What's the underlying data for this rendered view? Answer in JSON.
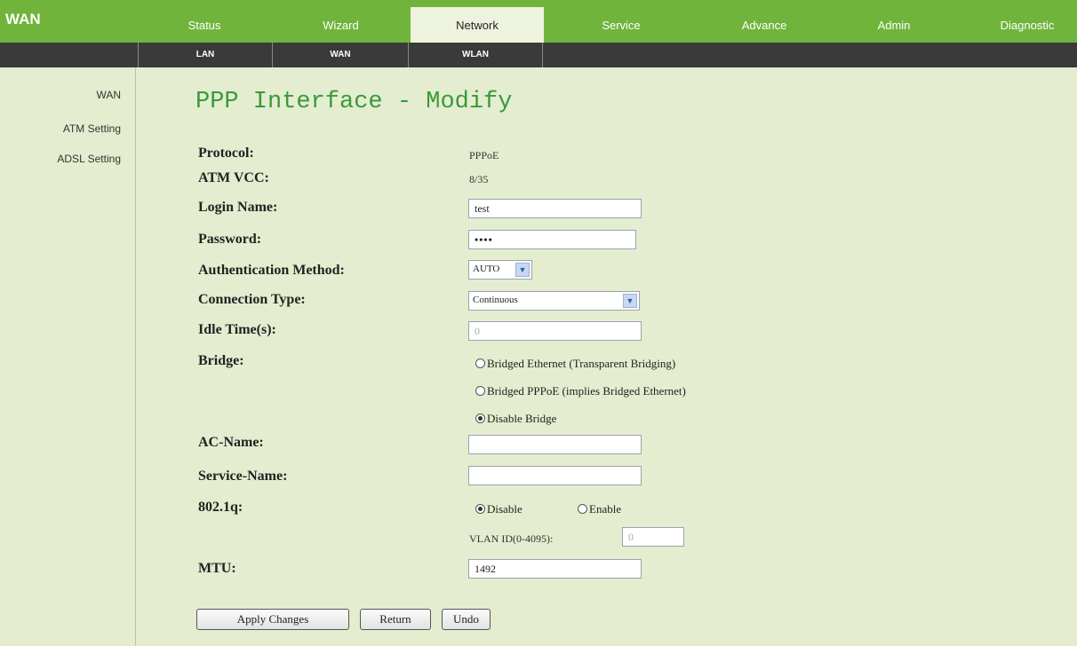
{
  "brand": "WAN",
  "nav": {
    "tabs": [
      "Status",
      "Wizard",
      "Network",
      "Service",
      "Advance",
      "Admin",
      "Diagnostic"
    ],
    "active": "Network",
    "subtabs": [
      "LAN",
      "WAN",
      "WLAN"
    ]
  },
  "sidebar": {
    "items": [
      "WAN",
      "ATM Setting",
      "ADSL Setting"
    ]
  },
  "page_title": "PPP Interface - Modify",
  "form": {
    "protocol": {
      "label": "Protocol:",
      "value": "PPPoE"
    },
    "atm_vcc": {
      "label": "ATM VCC:",
      "value": "8/35"
    },
    "login_name": {
      "label": "Login Name:",
      "value": "test"
    },
    "password": {
      "label": "Password:",
      "value": "••••"
    },
    "auth_method": {
      "label": "Authentication Method:",
      "value": "AUTO"
    },
    "connection_type": {
      "label": "Connection Type:",
      "value": "Continuous"
    },
    "idle_time": {
      "label": "Idle Time(s):",
      "value": "0"
    },
    "bridge": {
      "label": "Bridge:",
      "options": [
        "Bridged Ethernet (Transparent Bridging)",
        "Bridged PPPoE (implies Bridged Ethernet)",
        "Disable Bridge"
      ],
      "selected": "Disable Bridge"
    },
    "ac_name": {
      "label": "AC-Name:",
      "value": ""
    },
    "service_name": {
      "label": "Service-Name:",
      "value": ""
    },
    "dot1q": {
      "label": "802.1q:",
      "options": [
        "Disable",
        "Enable"
      ],
      "selected": "Disable"
    },
    "vlan_id": {
      "label": "VLAN ID(0-4095):",
      "value": "0"
    },
    "mtu": {
      "label": "MTU:",
      "value": "1492"
    }
  },
  "buttons": {
    "apply": "Apply Changes",
    "return": "Return",
    "undo": "Undo"
  }
}
